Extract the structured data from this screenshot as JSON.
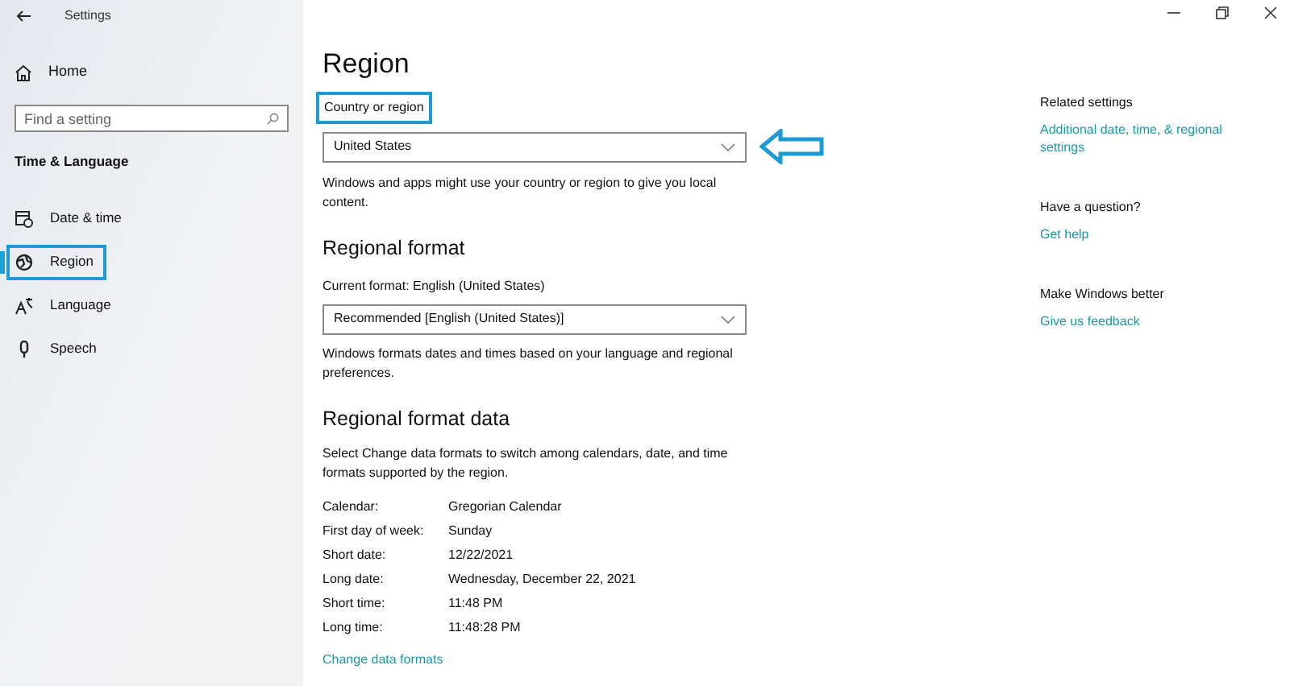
{
  "window": {
    "title": "Settings"
  },
  "sidebar": {
    "home": "Home",
    "search": {
      "placeholder": "Find a setting"
    },
    "section": "Time & Language",
    "items": [
      {
        "label": "Date & time",
        "selected": false,
        "highlighted": false
      },
      {
        "label": "Region",
        "selected": true,
        "highlighted": true
      },
      {
        "label": "Language",
        "selected": false,
        "highlighted": false
      },
      {
        "label": "Speech",
        "selected": false,
        "highlighted": false
      }
    ]
  },
  "page": {
    "title": "Region",
    "country": {
      "label": "Country or region",
      "label_highlighted": true,
      "value": "United States",
      "arrow_pointer": true,
      "description": "Windows and apps might use your country or region to give you local content."
    },
    "regional_format": {
      "heading": "Regional format",
      "label": "Current format: English (United States)",
      "value": "Recommended [English (United States)]",
      "description": "Windows formats dates and times based on your language and regional preferences."
    },
    "format_data": {
      "heading": "Regional format data",
      "description": "Select Change data formats to switch among calendars, date, and time formats supported by the region.",
      "rows": [
        {
          "label": "Calendar:",
          "value": "Gregorian Calendar"
        },
        {
          "label": "First day of week:",
          "value": "Sunday"
        },
        {
          "label": "Short date:",
          "value": "12/22/2021"
        },
        {
          "label": "Long date:",
          "value": "Wednesday, December 22, 2021"
        },
        {
          "label": "Short time:",
          "value": "11:48 PM"
        },
        {
          "label": "Long time:",
          "value": "11:48:28 PM"
        }
      ],
      "link": "Change data formats"
    }
  },
  "related": [
    {
      "heading": "Related settings",
      "link": "Additional date, time, & regional settings"
    },
    {
      "heading": "Have a question?",
      "link": "Get help"
    },
    {
      "heading": "Make Windows better",
      "link": "Give us feedback"
    }
  ]
}
